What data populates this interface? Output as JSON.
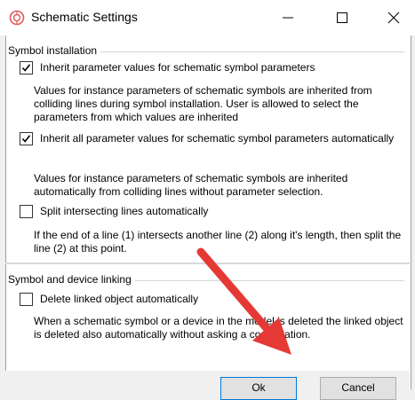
{
  "window": {
    "title": "Schematic Settings",
    "minimize_glyph": "—",
    "maximize_glyph": "☐",
    "close_glyph": "✕"
  },
  "groups": {
    "symbol_installation": {
      "title": "Symbol installation",
      "options": [
        {
          "label": "Inherit parameter values for schematic symbol parameters",
          "checked": true,
          "description": "Values for instance parameters of schematic symbols are inherited from colliding lines during symbol installation. User is allowed to select the parameters from which values are inherited"
        },
        {
          "label": "Inherit all parameter values for schematic symbol parameters automatically",
          "checked": true,
          "description": "Values for instance parameters of schematic symbols are inherited automatically from colliding lines without parameter selection."
        },
        {
          "label": "Split intersecting lines automatically",
          "checked": false,
          "description": "If the end of a line (1) intersects another line (2) along it's length, then split the line (2) at this point."
        }
      ]
    },
    "symbol_device_linking": {
      "title": "Symbol and device linking",
      "options": [
        {
          "label": "Delete linked object automatically",
          "checked": false,
          "description": "When a schematic symbol or a device in the model is deleted the linked object is deleted also automatically without asking a confirmation."
        }
      ]
    }
  },
  "buttons": {
    "ok": "Ok",
    "cancel": "Cancel"
  },
  "colors": {
    "annotation_arrow": "#e53935",
    "title_icon": "#e35a5a"
  }
}
